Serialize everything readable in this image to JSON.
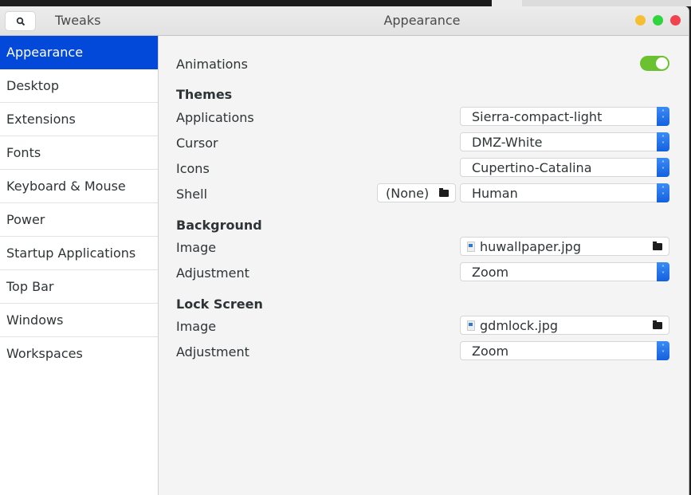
{
  "header": {
    "app_title": "Tweaks",
    "window_title": "Appearance",
    "search_icon": "search-icon",
    "window_controls": {
      "minimize": "#f6be32",
      "maximize": "#2fd43e",
      "close": "#f0434f"
    }
  },
  "sidebar": {
    "active_color": "#0249d9",
    "items": [
      {
        "label": "Appearance",
        "active": true
      },
      {
        "label": "Desktop"
      },
      {
        "label": "Extensions"
      },
      {
        "label": "Fonts"
      },
      {
        "label": "Keyboard & Mouse"
      },
      {
        "label": "Power"
      },
      {
        "label": "Startup Applications"
      },
      {
        "label": "Top Bar"
      },
      {
        "label": "Windows"
      },
      {
        "label": "Workspaces"
      }
    ]
  },
  "main": {
    "animations": {
      "label": "Animations",
      "enabled": true,
      "toggle_color": "#6cc131"
    },
    "themes": {
      "heading": "Themes",
      "applications": {
        "label": "Applications",
        "value": "Sierra-compact-light"
      },
      "cursor": {
        "label": "Cursor",
        "value": "DMZ-White"
      },
      "icons": {
        "label": "Icons",
        "value": "Cupertino-Catalina"
      },
      "shell": {
        "label": "Shell",
        "file_value": "(None)",
        "value": "Human"
      }
    },
    "background": {
      "heading": "Background",
      "image": {
        "label": "Image",
        "value": "huwallpaper.jpg"
      },
      "adjustment": {
        "label": "Adjustment",
        "value": "Zoom"
      }
    },
    "lock_screen": {
      "heading": "Lock Screen",
      "image": {
        "label": "Image",
        "value": "gdmlock.jpg"
      },
      "adjustment": {
        "label": "Adjustment",
        "value": "Zoom"
      }
    }
  }
}
